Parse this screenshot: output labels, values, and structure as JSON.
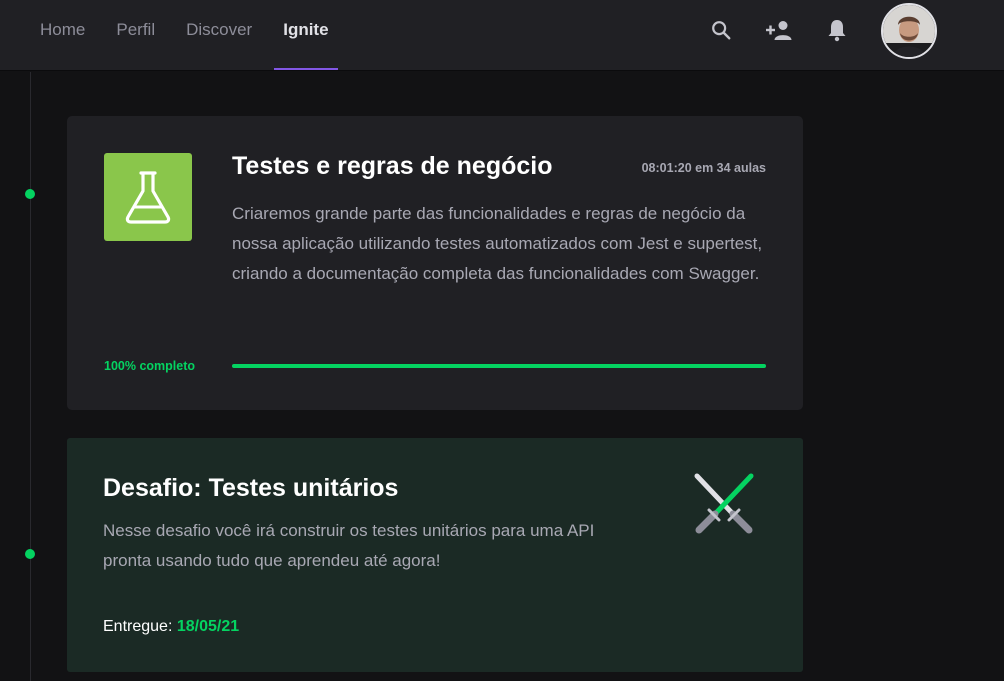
{
  "nav": {
    "items": [
      {
        "label": "Home",
        "active": false
      },
      {
        "label": "Perfil",
        "active": false
      },
      {
        "label": "Discover",
        "active": false
      },
      {
        "label": "Ignite",
        "active": true
      }
    ]
  },
  "header_icons": [
    "search-icon",
    "add-user-icon",
    "bell-icon",
    "avatar"
  ],
  "colors": {
    "accent": "#8257e5",
    "success": "#04d361",
    "card_bg": "#202024",
    "challenge_bg": "#1b2a25",
    "lesson_icon_bg": "#8ac64b"
  },
  "lesson": {
    "title": "Testes e regras de negócio",
    "duration": "08:01:20 em 34 aulas",
    "description": "Criaremos grande parte das funcionalidades e regras de negócio da nossa aplicação utilizando testes automatizados com Jest e supertest, criando a documentação completa das funcionalidades com Swagger.",
    "progress_label": "100% completo",
    "progress": 1.0,
    "icon": "flask-icon"
  },
  "challenge": {
    "title": "Desafio: Testes unitários",
    "description": "Nesse desafio você irá construir os testes unitários para uma API pronta usando tudo que aprendeu até agora!",
    "delivered_label": "Entregue:",
    "delivered_date": "18/05/21",
    "icon": "crossed-swords-icon"
  }
}
